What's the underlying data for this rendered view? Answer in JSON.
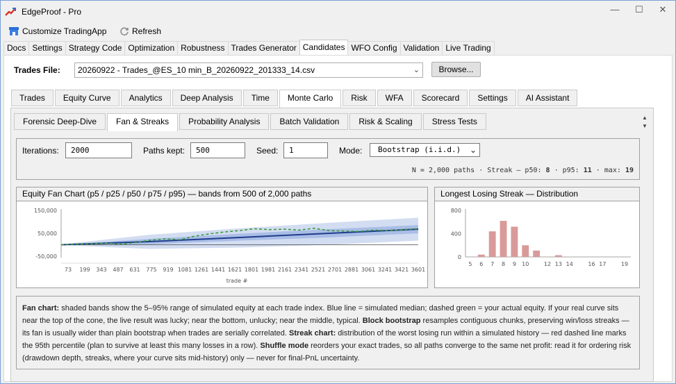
{
  "window": {
    "title": "EdgeProof - Pro",
    "controls": [
      "—",
      "☐",
      "✕"
    ]
  },
  "toolbar": {
    "customize_label": "Customize TradingApp",
    "refresh_label": "Refresh"
  },
  "main_tabs": [
    "Docs",
    "Settings",
    "Strategy Code",
    "Optimization",
    "Robustness",
    "Trades Generator",
    "Candidates",
    "WFO Config",
    "Validation",
    "Live Trading"
  ],
  "main_tabs_active": "Candidates",
  "trades_file": {
    "label": "Trades File:",
    "value": "20260922 - Trades_@ES_10 min_B_20260922_201333_14.csv",
    "browse_label": "Browse..."
  },
  "sub_tabs": [
    "Trades",
    "Equity Curve",
    "Analytics",
    "Deep Analysis",
    "Time",
    "Monte Carlo",
    "Risk",
    "WFA",
    "Scorecard",
    "Settings",
    "AI Assistant"
  ],
  "sub_tabs_active": "Monte Carlo",
  "inner_tabs": [
    "Forensic Deep-Dive",
    "Fan & Streaks",
    "Probability Analysis",
    "Batch Validation",
    "Risk & Scaling",
    "Stress Tests"
  ],
  "inner_tabs_active": "Fan & Streaks",
  "params": {
    "iterations_label": "Iterations:",
    "iterations_value": "2000",
    "paths_label": "Paths kept:",
    "paths_value": "500",
    "seed_label": "Seed:",
    "seed_value": "1",
    "mode_label": "Mode:",
    "mode_value": "Bootstrap (i.i.d.)"
  },
  "summary": {
    "prefix": "N = 2,000 paths · Streak — p50: ",
    "p50": "8",
    "mid": " · p95: ",
    "p95": "11",
    "mid2": " · max: ",
    "max": "19"
  },
  "chart_data": [
    {
      "type": "area",
      "title": "Equity Fan Chart (p5 / p25 / p50 / p75 / p95) — bands from 500 of 2,000 paths",
      "xlabel": "trade #",
      "ylabel": "",
      "x_ticks": [
        "73",
        "199",
        "343",
        "487",
        "631",
        "775",
        "919",
        "1081",
        "1261",
        "1441",
        "1621",
        "1801",
        "1981",
        "2161",
        "2341",
        "2521",
        "2701",
        "2881",
        "3061",
        "3241",
        "3421",
        "3601"
      ],
      "y_ticks": [
        "150,000",
        "50,000",
        "-50,000"
      ],
      "ylim": [
        -50000,
        150000
      ],
      "xlim": [
        0,
        3601
      ],
      "series": [
        {
          "name": "p5",
          "x": [
            0,
            900,
            1800,
            2700,
            3601
          ],
          "values": [
            -2000,
            -18000,
            -12000,
            0,
            18000
          ]
        },
        {
          "name": "p25",
          "x": [
            0,
            900,
            1800,
            2700,
            3601
          ],
          "values": [
            0,
            2000,
            18000,
            32000,
            50000
          ]
        },
        {
          "name": "p50",
          "x": [
            0,
            900,
            1800,
            2700,
            3601
          ],
          "values": [
            0,
            14000,
            32000,
            50000,
            68000
          ]
        },
        {
          "name": "p75",
          "x": [
            0,
            900,
            1800,
            2700,
            3601
          ],
          "values": [
            0,
            26000,
            48000,
            68000,
            86000
          ]
        },
        {
          "name": "p95",
          "x": [
            0,
            900,
            1800,
            2700,
            3601
          ],
          "values": [
            2000,
            44000,
            72000,
            96000,
            118000
          ]
        },
        {
          "name": "actual",
          "x": [
            0,
            150,
            300,
            450,
            600,
            750,
            900,
            1050,
            1200,
            1350,
            1500,
            1650,
            1800,
            1950,
            2100,
            2250,
            2400,
            2550,
            2700,
            2850,
            3000,
            3150,
            3300,
            3450,
            3601
          ],
          "values": [
            0,
            3000,
            4000,
            8000,
            2000,
            10000,
            20000,
            26000,
            22000,
            38000,
            48000,
            56000,
            62000,
            70000,
            66000,
            68000,
            64000,
            72000,
            62000,
            60000,
            58000,
            64000,
            62000,
            66000,
            70000
          ]
        }
      ],
      "colors": {
        "band_outer": "#d3ddf1",
        "band_inner": "#a9bde6",
        "median": "#1f3d8a",
        "actual": "#3c9a3c"
      }
    },
    {
      "type": "bar",
      "title": "Longest Losing Streak — Distribution",
      "xlabel": "",
      "ylabel": "",
      "categories": [
        "5",
        "6",
        "7",
        "8",
        "9",
        "10",
        "11",
        "12",
        "13",
        "14",
        "15",
        "16",
        "17",
        "18",
        "19"
      ],
      "tick_labels": [
        "5",
        "6",
        "7",
        "8",
        "9",
        "10",
        "12",
        "13",
        "14",
        "16",
        "17",
        "19"
      ],
      "values": [
        0,
        40,
        440,
        620,
        520,
        200,
        110,
        2,
        30,
        3,
        0,
        0,
        0,
        0,
        1
      ],
      "y_ticks": [
        "800",
        "400",
        "0"
      ],
      "ylim": [
        0,
        800
      ],
      "colors": {
        "bar": "#d99a9a"
      }
    }
  ],
  "notes": {
    "fan_label": "Fan chart:",
    "fan_text": " shaded bands show the 5–95% range of simulated equity at each trade index. Blue line = simulated median; dashed green = your actual equity. If your real curve sits near the top of the cone, the live result was lucky; near the bottom, unlucky; near the middle, typical. ",
    "block_label": "Block bootstrap",
    "block_text": " resamples contiguous chunks, preserving win/loss streaks — its fan is usually wider than plain bootstrap when trades are serially correlated. ",
    "streak_label": "Streak chart:",
    "streak_text": " distribution of the worst losing run within a simulated history — red dashed line marks the 95th percentile (plan to survive at least this many losses in a row). ",
    "shuffle_label": "Shuffle mode",
    "shuffle_text": " reorders your exact trades, so all paths converge to the same net profit: read it for ordering risk (drawdown depth, streaks, where your curve sits mid-history) only — never for final-PnL uncertainty."
  }
}
